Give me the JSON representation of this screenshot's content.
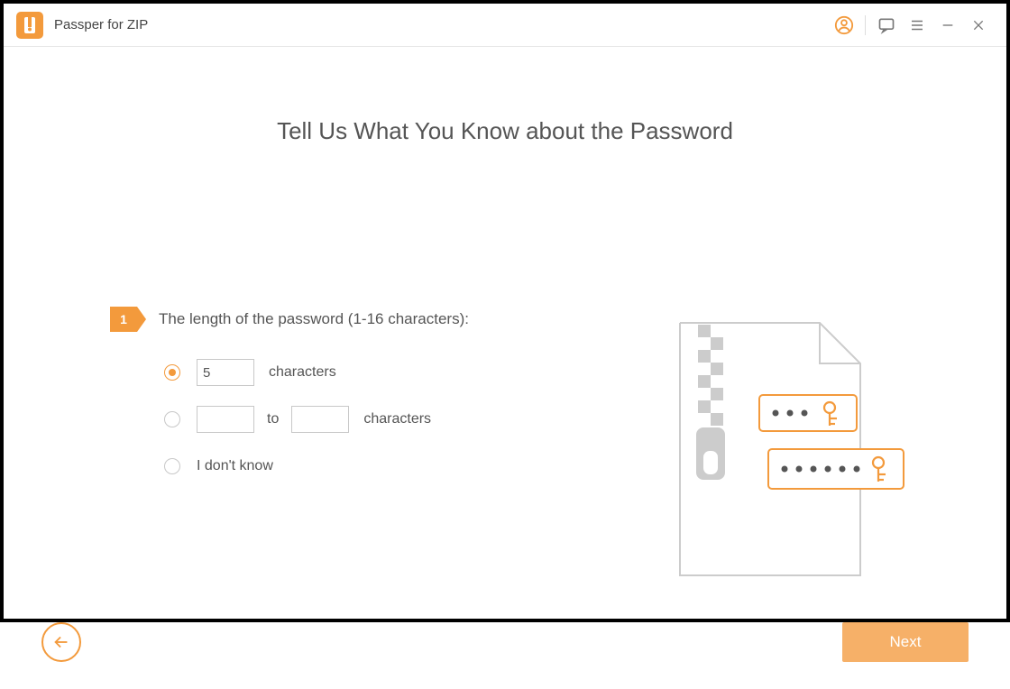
{
  "app": {
    "title": "Passper for ZIP"
  },
  "page": {
    "heading": "Tell Us What You Know about the Password",
    "step": {
      "num": "1",
      "text": "The length of the password (1-16 characters):"
    },
    "opt1": {
      "value": "5",
      "suffix": "characters"
    },
    "opt2": {
      "from": "",
      "word_to": "to",
      "to": "",
      "suffix": "characters"
    },
    "opt3": {
      "label": "I don't know"
    },
    "next": "Next"
  }
}
